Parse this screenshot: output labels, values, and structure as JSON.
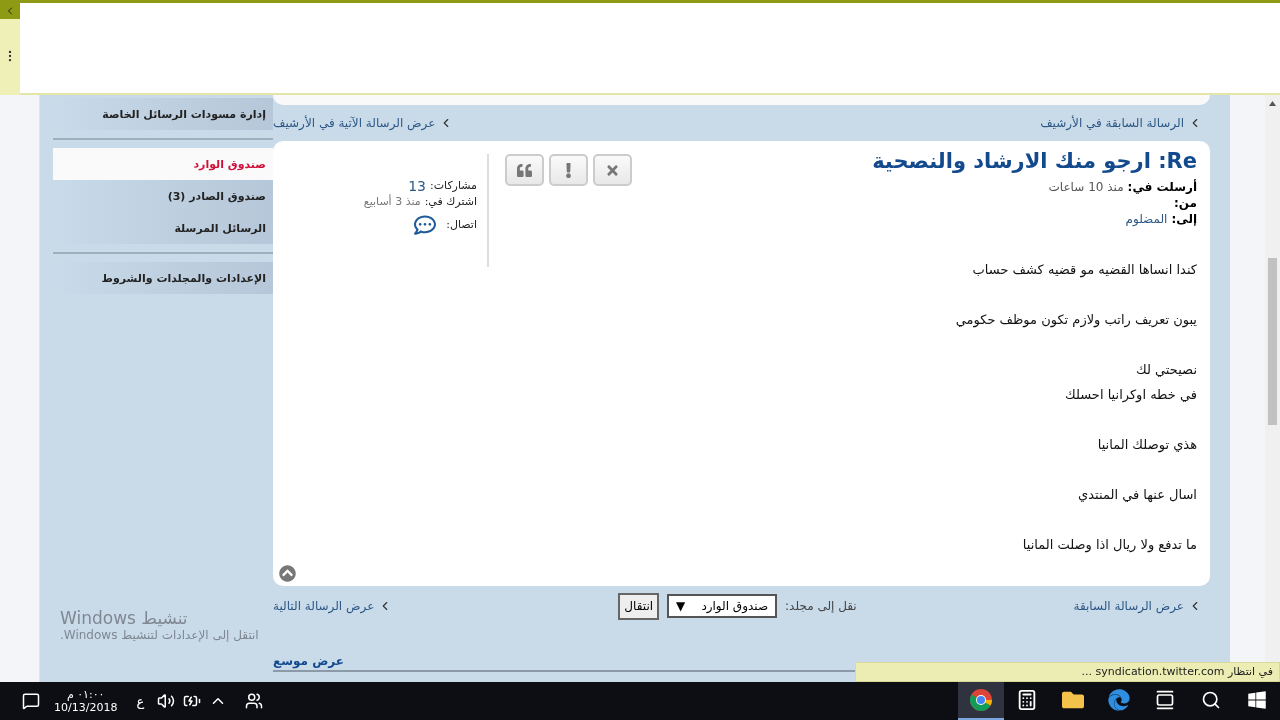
{
  "sidebar": {
    "groups": [
      {
        "items": [
          {
            "label": "إدارة مسودات الرسائل الخاصة",
            "selected": false
          }
        ]
      },
      {
        "items": [
          {
            "label": "صندوق الوارد",
            "selected": true
          },
          {
            "label": "صندوق الصادر (3)",
            "selected": false
          },
          {
            "label": "الرسائل المرسلة",
            "selected": false
          }
        ]
      },
      {
        "items": [
          {
            "label": "الإعدادات والمجلدات والشروط",
            "selected": false
          }
        ]
      }
    ]
  },
  "archive_nav": {
    "previous": "الرسالة السابقة في الأرشيف",
    "next": "عرض الرسالة الآتية في الأرشيف"
  },
  "message": {
    "title": "Re: ارجو منك الارشاد والنصحية",
    "meta": [
      {
        "label": "أرسلت في:",
        "value": "منذ 10 ساعات",
        "kind": "text"
      },
      {
        "label": "من:"
      },
      {
        "label": "إلى:",
        "value": "المضلوم",
        "kind": "link"
      }
    ],
    "body": [
      [
        "كندا انساها القضيه مو قضيه كشف حساب"
      ],
      [
        "يبون تعريف راتب ولازم تكون موظف حكومي"
      ],
      [
        "نصيحتي لك",
        "في خطه اوكرانيا احسلك"
      ],
      [
        "هذي توصلك المانيا"
      ],
      [
        "اسال عنها في المنتدي"
      ],
      [
        "ما تدفع ولا ريال اذا وصلت المانيا"
      ]
    ],
    "author": {
      "posts_label": "مشاركات:",
      "posts": "13",
      "joined_label": "اشترك في:",
      "joined": "منذ 3 أسابيع",
      "contact_label": "اتصال:"
    }
  },
  "footer_nav": {
    "previous": "عرض الرسالة السابقة",
    "move_label": "نقل إلى مجلد:",
    "folder": "صندوق الوارد",
    "folder_caret": "▼",
    "go_button": "انتقال",
    "next": "عرض الرسالة التالية"
  },
  "wide_view": "عرض موسع",
  "activation": {
    "title": "تنشيط Windows",
    "text": "انتقل إلى الإعدادات لتنشيط Windows."
  },
  "status_bubble": "في انتظار syndication.twitter.com ...",
  "taskbar": {
    "time": "٠١:٠٠ م",
    "date": "10/13/2018",
    "language": "ع",
    "apps": [
      {
        "kind": "chrome",
        "selected": true
      },
      {
        "kind": "calculator",
        "selected": false
      },
      {
        "kind": "folder",
        "selected": false
      },
      {
        "kind": "edge",
        "selected": false
      },
      {
        "kind": "taskview",
        "selected": false
      },
      {
        "kind": "search",
        "selected": false
      },
      {
        "kind": "windows",
        "selected": false
      }
    ]
  }
}
